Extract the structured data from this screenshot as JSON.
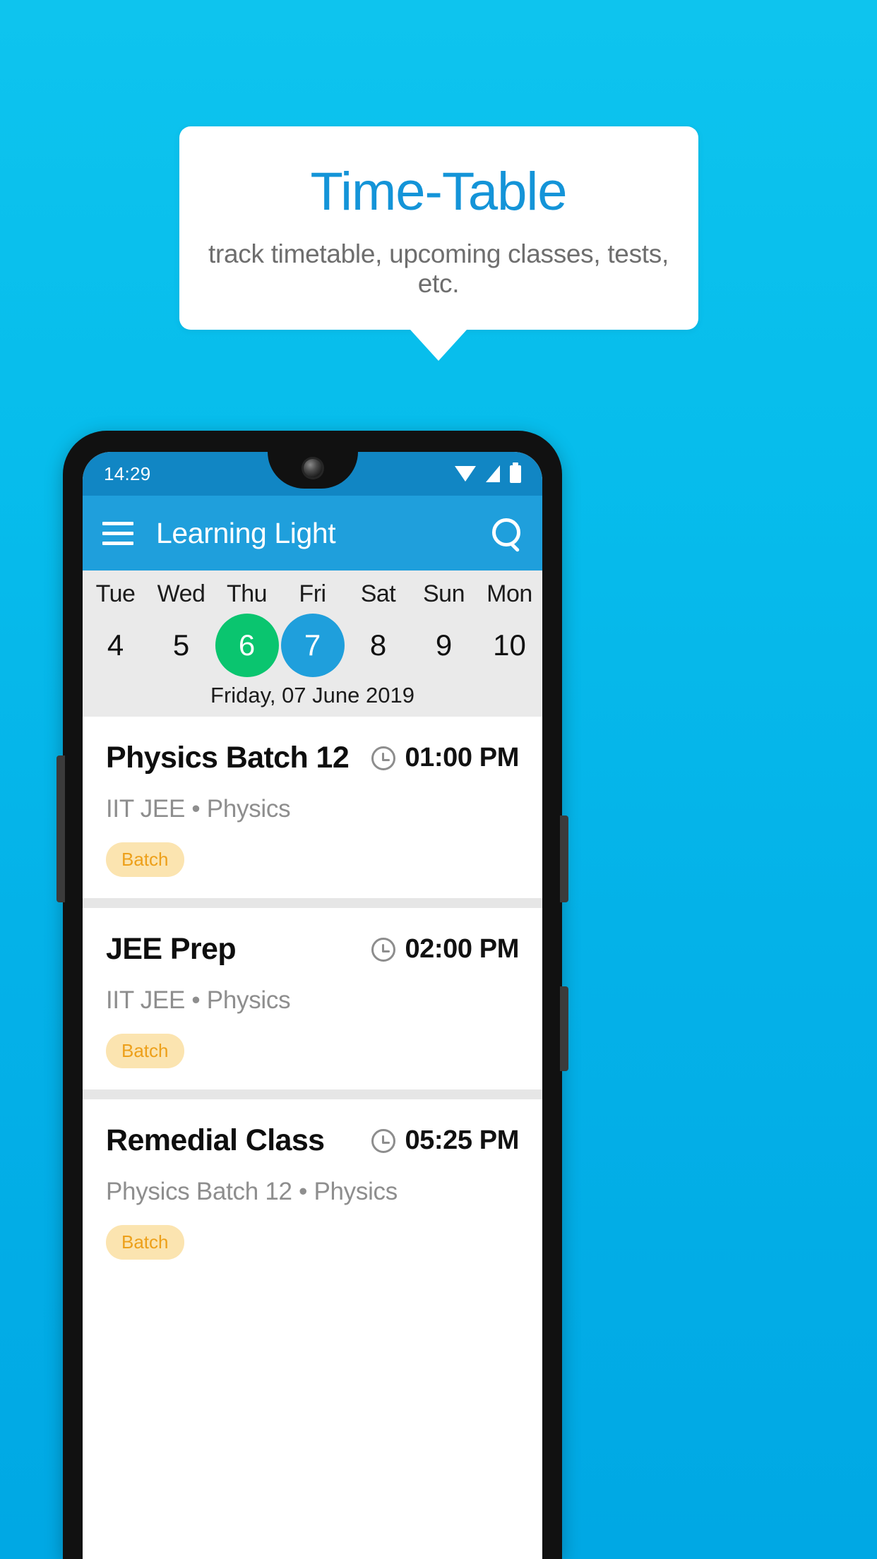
{
  "promo": {
    "title": "Time-Table",
    "subtitle": "track timetable, upcoming classes, tests, etc."
  },
  "colors": {
    "background_top": "#0ec4ee",
    "background_bottom": "#00a8e4",
    "accent_blue": "#1f9fdc",
    "statusbar_blue": "#1186c4",
    "today_green": "#0ac56f",
    "badge_bg": "#fbe4b0",
    "badge_text": "#eda01a",
    "title_blue": "#1494d8"
  },
  "statusbar": {
    "time": "14:29",
    "icons": [
      "wifi-icon",
      "signal-icon",
      "battery-icon"
    ]
  },
  "appbar": {
    "menu_icon": "hamburger-menu-icon",
    "title": "Learning Light",
    "search_icon": "search-icon"
  },
  "datestrip": {
    "days": [
      {
        "dow": "Tue",
        "num": "4",
        "state": "normal"
      },
      {
        "dow": "Wed",
        "num": "5",
        "state": "normal"
      },
      {
        "dow": "Thu",
        "num": "6",
        "state": "today"
      },
      {
        "dow": "Fri",
        "num": "7",
        "state": "selected"
      },
      {
        "dow": "Sat",
        "num": "8",
        "state": "normal"
      },
      {
        "dow": "Sun",
        "num": "9",
        "state": "normal"
      },
      {
        "dow": "Mon",
        "num": "10",
        "state": "normal"
      }
    ],
    "full_date": "Friday, 07 June 2019"
  },
  "classes": [
    {
      "title": "Physics Batch 12",
      "time": "01:00 PM",
      "subtitle": "IIT JEE • Physics",
      "badge": "Batch",
      "clock_icon": "clock-icon"
    },
    {
      "title": "JEE Prep",
      "time": "02:00 PM",
      "subtitle": "IIT JEE • Physics",
      "badge": "Batch",
      "clock_icon": "clock-icon"
    },
    {
      "title": "Remedial Class",
      "time": "05:25 PM",
      "subtitle": "Physics Batch 12 • Physics",
      "badge": "Batch",
      "clock_icon": "clock-icon"
    }
  ]
}
